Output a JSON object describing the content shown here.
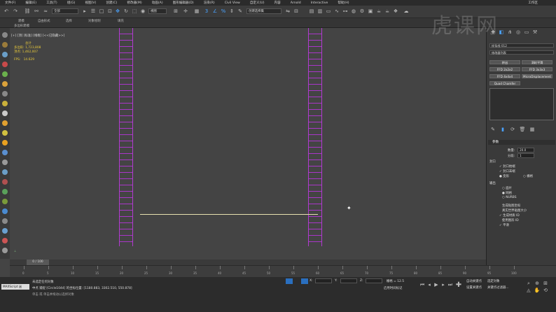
{
  "menubar": {
    "items": [
      "文件(F)",
      "编辑(E)",
      "工具(T)",
      "组(G)",
      "视图(V)",
      "创建(C)",
      "修改器(M)",
      "动画(A)",
      "图形编辑器(D)",
      "渲染(R)",
      "Civil View",
      "自定义(U)",
      "内容",
      "Arnold",
      "Interactive",
      "帮助(H)"
    ],
    "workspace": "工作区"
  },
  "toolbar": {
    "selection_filter": "全部",
    "view_dropdown": "视图",
    "named_selection": "创建选择集"
  },
  "ribbon": {
    "tabs": [
      "建模",
      "自由形式",
      "选择",
      "对象绘制",
      "填充"
    ],
    "sub_label": "多边形建模"
  },
  "viewport": {
    "label": "[+] [顶] [标准] [线框] [<<已隐藏>>]",
    "stats_title": "总计",
    "polys_label": "多边形:",
    "polys_value": "1,723,808",
    "verts_label": "顶点:",
    "verts_value": "1,462,007",
    "fps_label": "FPS:",
    "fps_value": "14.629"
  },
  "cmdpanel": {
    "object_name": "样条线 012",
    "modifier_list": "修改器列表",
    "btn_row1": [
      "挤出",
      "涡轮平滑"
    ],
    "btn_row2": [
      "FFD 2x2x2",
      "FFD 3x3x3"
    ],
    "btn_row3": [
      "FFD 4x4x4",
      "MicroDisplacement"
    ],
    "btn_row4": "Quad Chamfer",
    "params_title": "参数",
    "amount_label": "数量:",
    "amount_value": "20.0",
    "segments_label": "分段:",
    "segments_value": "1",
    "capping_title": "封口",
    "cap_start": "封口始端",
    "cap_end": "封口末端",
    "morph": "变形",
    "grid": "栅格",
    "output_title": "输出",
    "output_patch": "面片",
    "output_mesh": "网格",
    "output_nurbs": "NURBS",
    "gen_mapping": "生成贴图坐标",
    "real_world": "真实世界贴图大小",
    "gen_mat_ids": "生成材质 ID",
    "use_shape_ids": "使用图形 ID",
    "smooth": "平滑"
  },
  "timeline": {
    "slider": "0 / 100",
    "ticks": [
      "0",
      "5",
      "10",
      "15",
      "20",
      "25",
      "30",
      "35",
      "40",
      "45",
      "50",
      "55",
      "60",
      "65",
      "70",
      "75",
      "80",
      "85",
      "90",
      "95",
      "100"
    ]
  },
  "status": {
    "maxscript": "MAXScript 迷",
    "selection_msg": "未选定任何对象",
    "prompt": "单击 或 单击并拖动以选择对象",
    "hint": "中点 捕捉 [Circle1044] 的坐标位置: [1180.883, 3302.510, 550.878]",
    "x_label": "X:",
    "y_label": "Y:",
    "z_label": "Z:",
    "grid_label": "栅格 = 12.5",
    "time_tag": "启用时间标记",
    "auto_key": "自动关键点",
    "sel_set": "选定对象",
    "set_key": "设置关键点",
    "key_filter": "关键点过滤器..."
  },
  "watermark": "虎课网"
}
